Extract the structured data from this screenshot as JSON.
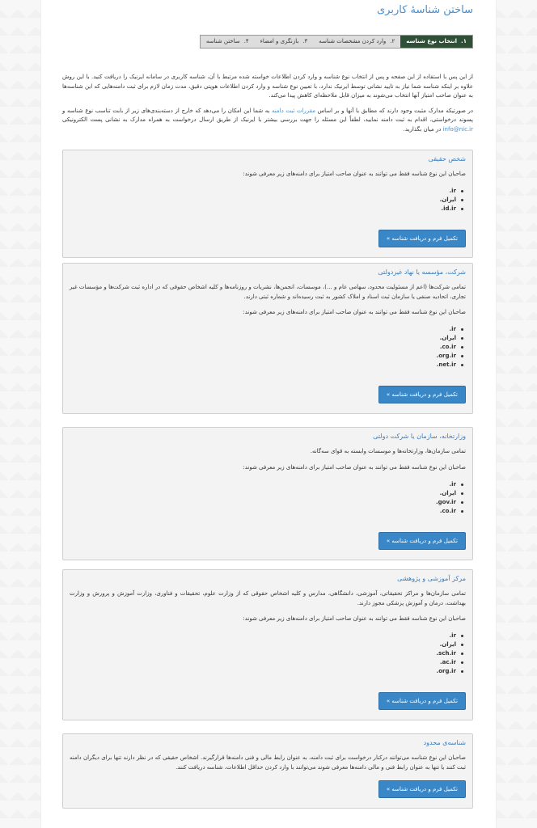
{
  "page": {
    "title": "ساختن شناسهٔ کاربری"
  },
  "steps": [
    {
      "num": "۱.",
      "label": "انتخاب نوع شناسه"
    },
    {
      "num": "۲.",
      "label": "وارد کردن مشخصات شناسه"
    },
    {
      "num": "۳.",
      "label": "بازنگری و امضاء"
    },
    {
      "num": "۴.",
      "label": "ساختن شناسه"
    }
  ],
  "intro": {
    "p1": "از این پس با استفاده از این صفحه و پس از انتخاب نوع شناسه و وارد کردن اطلاعات خواسته شده مرتبط با آن، شناسه کاربری در سامانه ایرنیک را دریافت کنید. با این روش علاوه بر اینکه شناسه شما نیاز به تایید نشانی توسط ایرنیک ندارد، با تعیین نوع شناسه و وارد کردن اطلاعات هویتی دقیق، مدت زمان لازم برای ثبت دامنه‌هایی که این شناسه‌ها به عنوان صاحب امتیاز آنها انتخاب می‌شوند به میزان قابل ملاحظه‌ای کاهش پیدا می‌کند.",
    "p2_before": "در صورتیکه مدارک مثبت وجود دارند که مطابق با آنها و بر اساس ",
    "p2_link": "مقررات ثبت دامنه",
    "p2_after": " به شما این امکان را می‌دهد که خارج از دسته‌بندی‌های زیر از بابت تناسب نوع شناسه و پسوند درخواستی، اقدام به ثبت دامنه نمایید، لطفاً این مسئله را جهت بررسی بیشتر با ایرنیک از طریق ارسال درخواست به همراه مدارک به نشانی پست الکترونیکی ",
    "p2_email": "info@nic.ir",
    "p2_end": " در میان بگذارید."
  },
  "common": {
    "note": "صاحبان این نوع شناسه فقط می توانند به عنوان صاحب امتیاز برای دامنه‌های زیر معرفی شوند:",
    "button_label": "تکمیل فرم و دریافت شناسه »"
  },
  "cards": [
    {
      "title": "شخص حقیقی",
      "desc": "",
      "domains": [
        ".ir",
        ".ایران",
        ".id.ir"
      ]
    },
    {
      "title": "شرکت، مؤسسه یا نهاد غیردولتی",
      "desc": "تمامی شرکت‌ها (اعم از مسئولیت محدود، سهامی عام و ...)، موسسات، انجمن‌ها، نشریات و روزنامه‌ها و کلیه اشخاص حقوقی که در اداره ثبت شرکت‌ها و مؤسسات غیر تجاری، اتحادیه صنفی یا سازمان ثبت اسناد و املاک کشور به ثبت رسیده‌اند و شماره ثبتی دارند.",
      "domains": [
        ".ir",
        ".ایران",
        ".co.ir",
        ".org.ir",
        ".net.ir"
      ]
    },
    {
      "title": "وزارتخانه، سازمان یا شرکت دولتی",
      "desc": "تمامی سازمان‌ها، وزارتخانه‌ها و موسسات وابسته به قوای سه‌گانه.",
      "domains": [
        ".ir",
        ".ایران",
        ".gov.ir",
        ".co.ir"
      ]
    },
    {
      "title": "مرکز آموزشی و پژوهشی",
      "desc": "تمامی سازمان‌ها و مراکز تحقیقاتی، آموزشی، دانشگاهی، مدارس و کلیه اشخاص حقوقی که از وزارت علوم، تحقیقات و فناوری، وزارت آموزش و پرورش و وزارت بهداشت، درمان و آموزش پزشکی مجوز دارند.",
      "domains": [
        ".ir",
        ".ایران",
        ".sch.ir",
        ".ac.ir",
        ".org.ir"
      ]
    },
    {
      "title": "شناسه‌ی محدود",
      "desc": "صاحبان این نوع شناسه می‌توانند درکنار درخواست برای ثبت دامنه، به عنوان رابط مالی و فنی دامنه‌ها قرارگیرند. اشخاص حقیقی که در نظر دارند تنها برای دیگران دامنه ثبت کنند یا تنها به عنوان رابط فنی و مالی دامنه‌ها معرفی شوند می‌توانند با وارد کردن حداقل اطلاعات، شناسه دریافت کنند.",
      "domains": []
    }
  ]
}
